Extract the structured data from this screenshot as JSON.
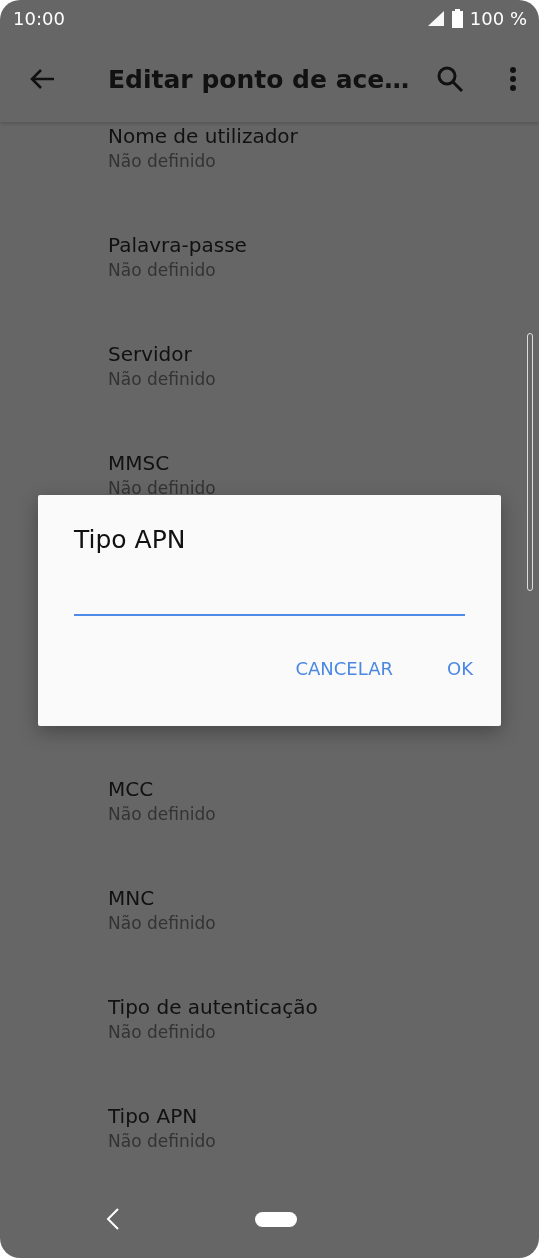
{
  "status_bar": {
    "time": "10:00",
    "battery": "100 %"
  },
  "app_bar": {
    "title": "Editar ponto de ace…"
  },
  "settings_above": [
    {
      "title": "Nome de utilizador",
      "value": "Não definido"
    },
    {
      "title": "Palavra-passe",
      "value": "Não definido"
    },
    {
      "title": "Servidor",
      "value": "Não definido"
    },
    {
      "title": "MMSC",
      "value": "Não definido"
    }
  ],
  "settings_below": [
    {
      "title": "MCC",
      "value": "Não definido"
    },
    {
      "title": "MNC",
      "value": "Não definido"
    },
    {
      "title": "Tipo de autenticação",
      "value": "Não definido"
    },
    {
      "title": "Tipo APN",
      "value": "Não definido"
    }
  ],
  "dialog": {
    "title": "Tipo APN",
    "buttons": [
      "CANCELAR",
      "OK"
    ]
  }
}
